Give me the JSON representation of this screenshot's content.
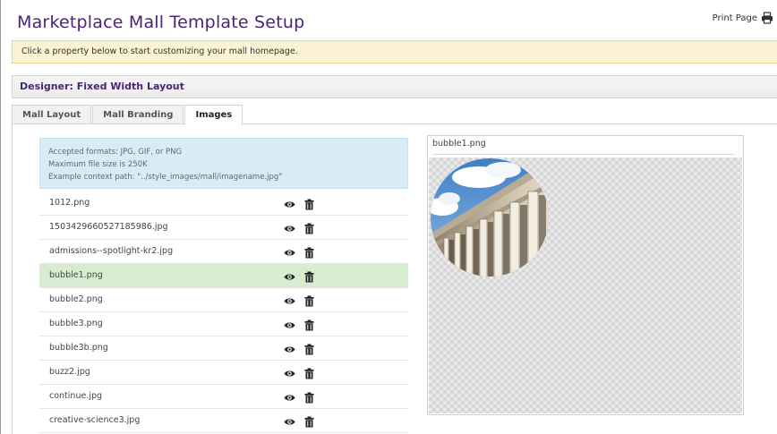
{
  "header": {
    "title": "Marketplace Mall Template Setup",
    "print_label": "Print Page"
  },
  "notice": {
    "text": "Click a property below to start customizing your mall homepage."
  },
  "designer": {
    "title": "Designer: Fixed Width Layout"
  },
  "tabs": [
    {
      "label": "Mall Layout",
      "active": false
    },
    {
      "label": "Mall Branding",
      "active": false
    },
    {
      "label": "Images",
      "active": true
    }
  ],
  "info": {
    "formats": "Accepted formats: JPG, GIF, or PNG",
    "max_size": "Maximum file size is 250K",
    "context_path": "Example context path: \"../style_images/mall/imagename.jpg\""
  },
  "files": [
    {
      "name": "1012.png"
    },
    {
      "name": "1503429660527185986.jpg"
    },
    {
      "name": "admissions--spotlight-kr2.jpg"
    },
    {
      "name": "bubble1.png"
    },
    {
      "name": "bubble2.png"
    },
    {
      "name": "bubble3.png"
    },
    {
      "name": "bubble3b.png"
    },
    {
      "name": "buzz2.jpg"
    },
    {
      "name": "continue.jpg"
    },
    {
      "name": "creative-science3.jpg"
    }
  ],
  "selected_file": "bubble1.png",
  "preview": {
    "title": "bubble1.png"
  },
  "icons": {
    "print": "printer-icon",
    "view": "eye-icon",
    "delete": "trash-icon"
  },
  "colors": {
    "title": "#4b2377",
    "notice_bg": "#fbf1d3",
    "info_bg": "#d9ebf6",
    "selected_row": "#d7ecd0"
  }
}
